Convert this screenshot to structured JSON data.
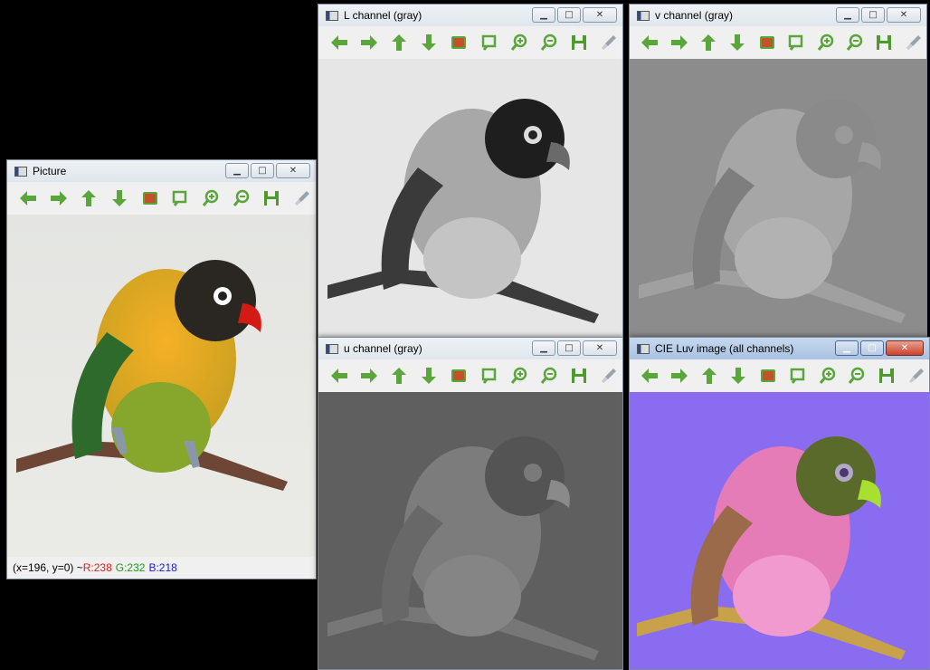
{
  "windows": {
    "picture": {
      "title": "Picture"
    },
    "l_channel": {
      "title": "L channel (gray)"
    },
    "v_channel": {
      "title": "v channel (gray)"
    },
    "u_channel": {
      "title": "u channel (gray)"
    },
    "luv": {
      "title": "CIE Luv image (all channels)"
    }
  },
  "status": {
    "coords": "(x=196, y=0) ~ ",
    "r": "R:238",
    "g": "G:232",
    "b": "B:218"
  },
  "toolbar_icons": [
    "arrow-left-icon",
    "arrow-right-icon",
    "arrow-up-icon",
    "arrow-down-icon",
    "image-icon",
    "zoom-fit-icon",
    "zoom-in-icon",
    "zoom-out-icon",
    "save-icon",
    "properties-icon"
  ],
  "colors": {
    "toolbar_green": "#5aa63c",
    "save_green": "#4e9a2f",
    "luv_background": "#8a6cf0",
    "error_red": "#e0201a"
  }
}
